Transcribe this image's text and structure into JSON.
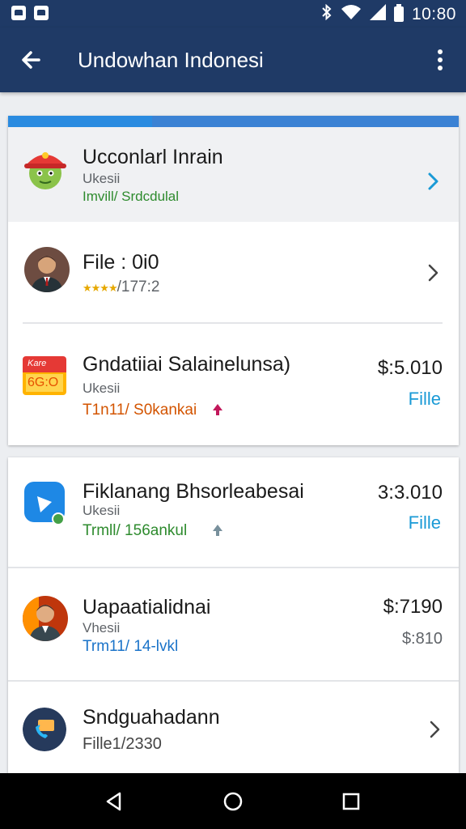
{
  "status_bar": {
    "time": "10:80",
    "icons": [
      "image-icon",
      "photo-icon",
      "bluetooth-icon",
      "wifi-icon",
      "signal-icon",
      "battery-icon"
    ]
  },
  "app_bar": {
    "title": "Undowhan Indonesi",
    "back_icon": "back-arrow-icon",
    "menu_icon": "more-vert-icon"
  },
  "list_card_1": {
    "progress": 0.32,
    "items": [
      {
        "title": "Ucconlarl Inrain",
        "subtitle": "Ukesii",
        "meta": "Imvill/ Srdcdulal",
        "icon": "cartoon-mascot-icon",
        "action_icon": "chevron-right-icon"
      },
      {
        "title": "File : 0i0",
        "meta": "/177:2",
        "rating_icons": "stars-icon",
        "icon": "person-avatar",
        "action_icon": "chevron-right-icon"
      },
      {
        "title": "Gndatiiai Salainelunsa)",
        "subtitle": "Ukesii",
        "meta": "T1n11/ S0kankai",
        "trend_icon": "arrow-up-icon",
        "icon": "ticket-thumbnail",
        "thumb_text_top": "Kare",
        "thumb_text_bottom": "6G:O",
        "price": "$:5.010",
        "link": "Fille"
      }
    ]
  },
  "list_card_2": {
    "items": [
      {
        "title": "Fiklanang Bhsorleabesai",
        "subtitle": "Ukesii",
        "meta": "Trmll/ 156ankul",
        "trend_icon": "arrow-up-icon",
        "icon": "app-logo-icon",
        "price": "3:3.010",
        "link": "Fille"
      },
      {
        "title": "Uapaatialidnai",
        "subtitle": "Vhesii",
        "meta": "Trm11/ 14-lvkl",
        "icon": "person-avatar",
        "price": "$:7190",
        "price_sub": "$:810"
      },
      {
        "title": "Sndguahadann",
        "subtitle": "Fille1/2330",
        "icon": "phone-badge-icon",
        "action_icon": "chevron-right-icon"
      }
    ]
  },
  "nav_bar": {
    "buttons": [
      "back-triangle-icon",
      "home-circle-icon",
      "recents-square-icon"
    ]
  },
  "colors": {
    "app_bar": "#1f3a66",
    "accent_blue": "#1a9ad6",
    "meta_green": "#2e8b2e",
    "meta_orange": "#d35400",
    "meta_blue": "#1a73c9"
  }
}
